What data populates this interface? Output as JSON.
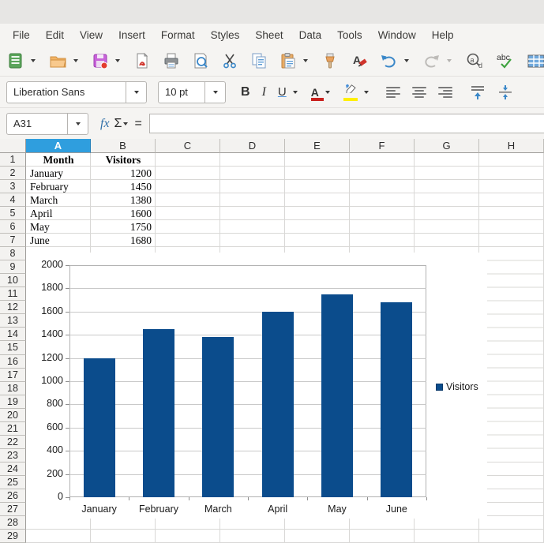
{
  "menu": {
    "items": [
      "File",
      "Edit",
      "View",
      "Insert",
      "Format",
      "Styles",
      "Sheet",
      "Data",
      "Tools",
      "Window",
      "Help"
    ]
  },
  "main_toolbar": {
    "icons": [
      "new-document",
      "open",
      "save",
      "export-pdf",
      "print",
      "print-preview",
      "cut",
      "copy",
      "paste",
      "clone-formatting",
      "clear-formatting",
      "undo",
      "redo",
      "find-and-replace",
      "spelling",
      "borders-table",
      "freeze-panes"
    ]
  },
  "format_toolbar": {
    "font_name": "Liberation Sans",
    "font_size": "10 pt",
    "bold_label": "B",
    "italic_label": "I",
    "underline_label": "U",
    "font_color_label": "A",
    "icons": [
      "bold",
      "italic",
      "underline",
      "font-color",
      "highlight-color",
      "align-left",
      "align-center",
      "align-right",
      "align-top",
      "center-vertically"
    ]
  },
  "formula_bar": {
    "cell_reference": "A31",
    "fx_label": "fx",
    "sum_label": "Σ",
    "equals_label": "=",
    "input_value": ""
  },
  "sheet": {
    "column_headers": [
      "A",
      "B",
      "C",
      "D",
      "E",
      "F",
      "G",
      "H"
    ],
    "selected_column": "A",
    "row_numbers": [
      1,
      2,
      3,
      4,
      5,
      6,
      7,
      8,
      9,
      10,
      11,
      12,
      13,
      14,
      15,
      16,
      17,
      18,
      19,
      20,
      21,
      22,
      23,
      24,
      25,
      26,
      27,
      28,
      29
    ],
    "table": {
      "headers": [
        "Month",
        "Visitors"
      ],
      "rows": [
        [
          "January",
          "1200"
        ],
        [
          "February",
          "1450"
        ],
        [
          "March",
          "1380"
        ],
        [
          "April",
          "1600"
        ],
        [
          "May",
          "1750"
        ],
        [
          "June",
          "1680"
        ]
      ]
    }
  },
  "chart_data": {
    "type": "bar",
    "title": "",
    "categories": [
      "January",
      "February",
      "March",
      "April",
      "May",
      "June"
    ],
    "series": [
      {
        "name": "Visitors",
        "values": [
          1200,
          1450,
          1380,
          1600,
          1750,
          1680
        ]
      }
    ],
    "xlabel": "",
    "ylabel": "",
    "ylim": [
      0,
      2000
    ],
    "ytick_step": 200,
    "grid": true,
    "legend_position": "right",
    "bar_color": "#0b4c8c"
  }
}
